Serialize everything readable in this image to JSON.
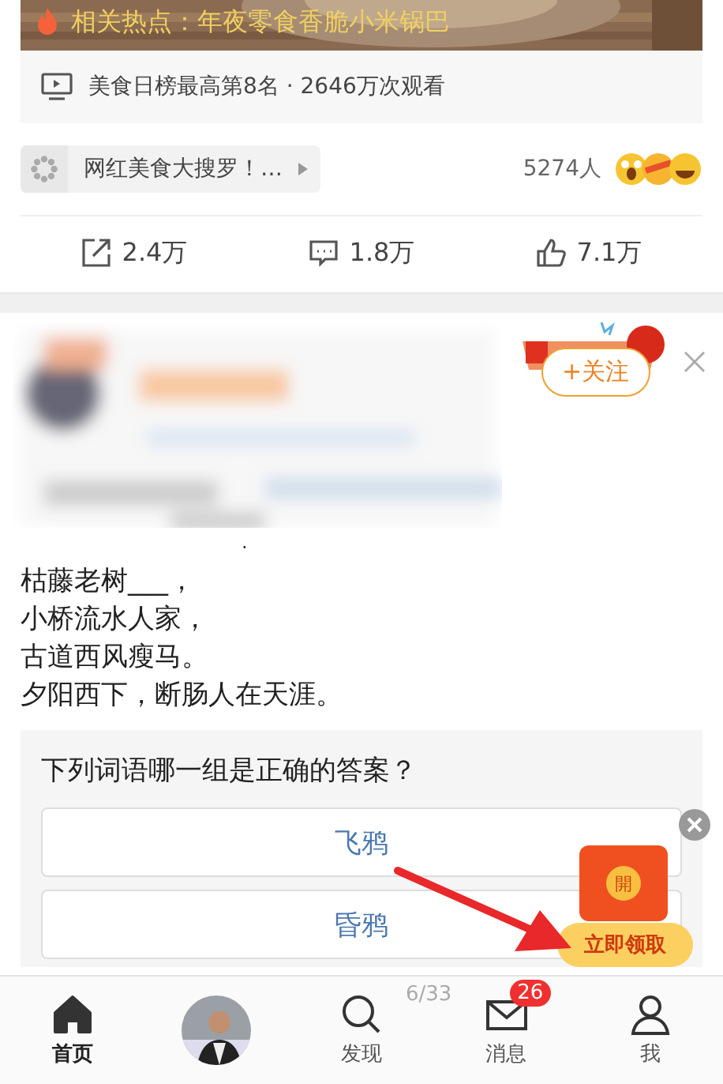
{
  "hot_topic": {
    "text": "相关热点：年夜零食香脆小米锅巴"
  },
  "video_stats": "美食日榜最高第8名 · 2646万次观看",
  "topic_tag": {
    "text": "网红美食大搜罗！…"
  },
  "reactions": {
    "count": "5274人"
  },
  "actions": [
    {
      "kind": "share",
      "count": "2.4万"
    },
    {
      "kind": "comment",
      "count": "1.8万"
    },
    {
      "kind": "like",
      "count": "7.1万"
    }
  ],
  "post": {
    "follow_button": "+关注",
    "dot": "."
  },
  "poem": [
    "枯藤老树___，",
    "小桥流水人家，",
    "古道西风瘦马。",
    "夕阳西下，断肠人在天涯。"
  ],
  "quiz": {
    "question": "下列词语哪一组是正确的答案？",
    "options": [
      {
        "text": "飞鸦"
      },
      {
        "text": "昏鸦"
      }
    ]
  },
  "red_packet": {
    "seal": "開",
    "button": "立即领取"
  },
  "tab_bar": [
    {
      "kind": "home",
      "label": "首页",
      "selected": true
    },
    {
      "kind": "avatar",
      "selected": false
    },
    {
      "kind": "discover",
      "label": "发现",
      "counter": "6/33",
      "selected": false
    },
    {
      "kind": "messages",
      "label": "消息",
      "badge": "26",
      "selected": false
    },
    {
      "kind": "me",
      "label": "我",
      "selected": false
    }
  ]
}
